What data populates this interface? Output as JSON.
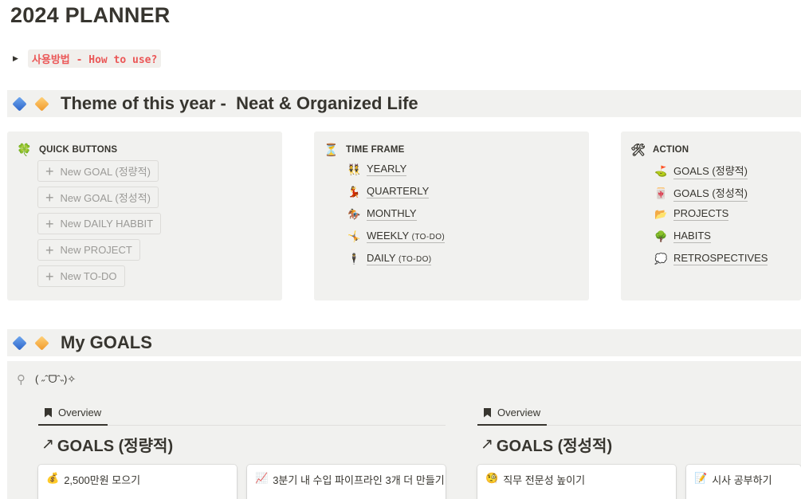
{
  "page": {
    "title": "2024 PLANNER"
  },
  "how_to": {
    "label": "사용방법 - How to use?"
  },
  "theme": {
    "prefix": "Theme of this year -",
    "title": "Neat & Organized Life"
  },
  "quick_buttons": {
    "title": "QUICK BUTTONS",
    "icon": "🍀",
    "buttons": [
      "New GOAL (정량적)",
      "New GOAL (정성적)",
      "New DAILY HABBIT",
      "New PROJECT",
      "New TO-DO"
    ]
  },
  "time_frame": {
    "title": "TIME FRAME",
    "icon": "⏳",
    "items": [
      {
        "icon": "👯",
        "label": "YEARLY",
        "suffix": ""
      },
      {
        "icon": "💃",
        "label": "QUARTERLY",
        "suffix": ""
      },
      {
        "icon": "🏇",
        "label": "MONTHLY",
        "suffix": ""
      },
      {
        "icon": "🤸",
        "label": "WEEKLY ",
        "suffix": "(TO-DO)"
      },
      {
        "icon": "🕴",
        "label": "DAILY ",
        "suffix": "(TO-DO)"
      }
    ]
  },
  "action": {
    "title": "ACTION",
    "icon": "🛠",
    "items": [
      {
        "icon": "⛳",
        "label": "GOALS (정량적)"
      },
      {
        "icon": "🀄",
        "label": "GOALS (정성적)"
      },
      {
        "icon": "📂",
        "label": "PROJECTS"
      },
      {
        "icon": "🌳",
        "label": "HABITS"
      },
      {
        "icon": "💭",
        "label": "RETROSPECTIVES"
      }
    ]
  },
  "my_goals": {
    "title": "My GOALS",
    "kaomoji": "( ˶ˆᗜˆ˵)✧",
    "left": {
      "tab": "Overview",
      "title": "GOALS (정량적)",
      "cards": [
        {
          "icon": "💰",
          "label": "2,500만원 모으기"
        },
        {
          "icon": "📈",
          "label": "3분기 내 수입 파이프라인 3개 더 만들기"
        }
      ]
    },
    "right": {
      "tab": "Overview",
      "title": "GOALS (정성적)",
      "cards": [
        {
          "icon": "🧐",
          "label": "직무 전문성 높이기"
        },
        {
          "icon": "📝",
          "label": "시사 공부하기"
        }
      ]
    }
  },
  "colors": {
    "band_bg": "#f1f1ef",
    "code_red": "#eb5757",
    "text": "#37352f",
    "muted": "#9b9a97"
  }
}
